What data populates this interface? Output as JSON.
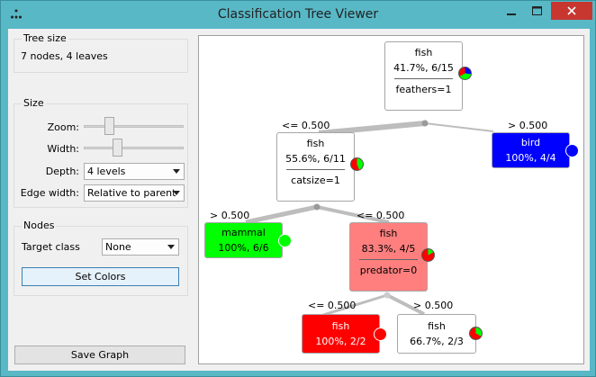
{
  "window": {
    "title": "Classification Tree Viewer"
  },
  "left_panel": {
    "tree_size": {
      "group_title": "Tree size",
      "value": "7 nodes, 4 leaves"
    },
    "size": {
      "group_title": "Size",
      "zoom_label": "Zoom:",
      "width_label": "Width:",
      "depth_label": "Depth:",
      "depth_value": "4 levels",
      "edge_width_label": "Edge width:",
      "edge_width_value": "Relative to parent"
    },
    "nodes": {
      "group_title": "Nodes",
      "target_class_label": "Target class",
      "target_class_value": "None",
      "set_colors_label": "Set Colors"
    },
    "save_graph_label": "Save Graph"
  },
  "tree": {
    "colors": {
      "fish": "#ff0000",
      "bird": "#0000ff",
      "mammal": "#00ff00",
      "fish_light": "#ff7f7f"
    },
    "nodes": [
      {
        "id": "root",
        "class": "fish",
        "stats": "41.7%, 6/15",
        "split": "feathers=1"
      },
      {
        "id": "n1",
        "class": "fish",
        "stats": "55.6%, 6/11",
        "split": "catsize=1"
      },
      {
        "id": "n2",
        "class": "bird",
        "stats": "100%, 4/4"
      },
      {
        "id": "n3",
        "class": "mammal",
        "stats": "100%, 6/6"
      },
      {
        "id": "n4",
        "class": "fish",
        "stats": "83.3%, 4/5",
        "split": "predator=0"
      },
      {
        "id": "n5",
        "class": "fish",
        "stats": "100%, 2/2"
      },
      {
        "id": "n6",
        "class": "fish",
        "stats": "66.7%, 2/3"
      }
    ],
    "edge_labels": {
      "root_left": "<= 0.500",
      "root_right": "> 0.500",
      "n1_left": "> 0.500",
      "n1_right": "<= 0.500",
      "n4_left": "<= 0.500",
      "n4_right": "> 0.500"
    }
  }
}
